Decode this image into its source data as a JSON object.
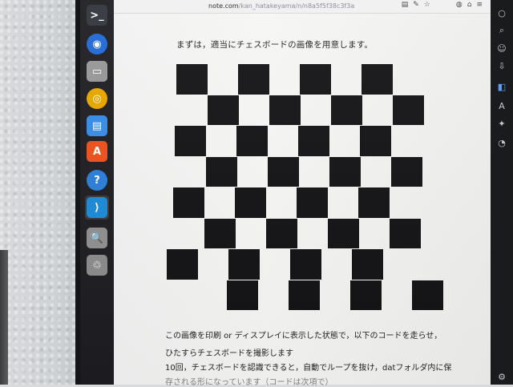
{
  "browser": {
    "url_host": "note.com",
    "url_path": "/kan_hatakeyama/n/n8a5f5f38c3f3a",
    "toolbar_icons": [
      "reader-icon",
      "extensions-icon",
      "bookmark-star-icon",
      "account-icon",
      "home-icon",
      "menu-icon"
    ]
  },
  "dock": {
    "items": [
      {
        "name": "terminal-icon",
        "glyph": ">_",
        "color": "#3b3f45"
      },
      {
        "name": "browser-icon",
        "glyph": "◉",
        "color": "#2a6fd6"
      },
      {
        "name": "files-icon",
        "glyph": "▭",
        "color": "#9a9a9a"
      },
      {
        "name": "rhythmbox-icon",
        "glyph": "◎",
        "color": "#e6a800"
      },
      {
        "name": "document-icon",
        "glyph": "▤",
        "color": "#3a8ee6"
      },
      {
        "name": "software-center-icon",
        "glyph": "A",
        "color": "#e95420"
      },
      {
        "name": "help-icon",
        "glyph": "?",
        "color": "#2f7fd6"
      },
      {
        "name": "vscode-icon",
        "glyph": "⟩",
        "color": "#1f8ad6"
      },
      {
        "name": "image-viewer-icon",
        "glyph": "🔍",
        "color": "#8e8e8e"
      },
      {
        "name": "trash-icon",
        "glyph": "♲",
        "color": "#8a8a8a"
      }
    ]
  },
  "article": {
    "intro": "まずは，適当にチェスボードの画像を用意します。",
    "para1": "この画像を印刷 or ディスプレイに表示した状態で，以下のコードを走らせ，",
    "para2": "ひたすらチェスボードを撮影します",
    "para3": "10回，チェスボードを認識できると，自動でループを抜け，datフォルダ内に保",
    "para4": "存される形になっています（コードは次項で）"
  },
  "chessboard": {
    "rows": 8,
    "cols": 8,
    "dark_color": "#121214",
    "light_color": "#f4f4f2"
  },
  "colors": {
    "dock_bg": "#1c1c20",
    "accent": "#e95420"
  }
}
